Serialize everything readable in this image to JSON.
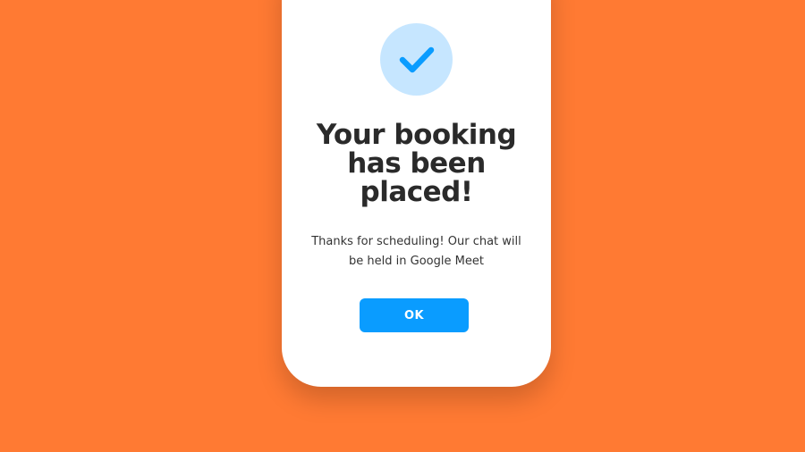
{
  "dialog": {
    "icon": "checkmark-icon",
    "title": "Your booking has been placed!",
    "message": "Thanks for scheduling! Our chat will be held in Google Meet",
    "ok_label": "OK"
  },
  "colors": {
    "background": "#FF7A33",
    "card": "#FFFFFF",
    "badge_fill": "#C6E6FF",
    "check": "#0A9CFF",
    "button": "#0A9CFF",
    "button_text": "#FFFFFF",
    "title_text": "#2A2A2A"
  }
}
